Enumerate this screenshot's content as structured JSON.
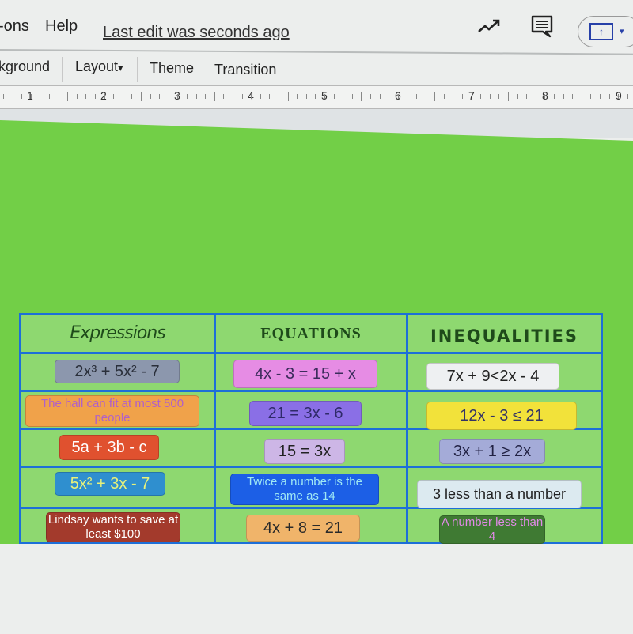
{
  "menubar": {
    "items": [
      "-ons",
      "Help"
    ],
    "last_edit": "Last edit was seconds ago",
    "icons": [
      "activity-trend-icon",
      "comment-icon",
      "present-icon"
    ],
    "present_caret": "▾",
    "present_arrow": "↑"
  },
  "toolbar": {
    "items": [
      "kground",
      "Layout",
      "Theme",
      "Transition"
    ],
    "layout_caret": "▾"
  },
  "ruler": {
    "numbers": [
      "1",
      "2",
      "3",
      "4",
      "5",
      "6",
      "7",
      "8",
      "9"
    ]
  },
  "colors": {
    "slide_background": "#72cf47",
    "table_border": "#1d6fd8",
    "table_cell": "#8ed870"
  },
  "table": {
    "headers": [
      "Expressions",
      "EQUATIONS",
      "INEQUALITIES"
    ],
    "columns": [
      {
        "name": "expressions",
        "cards": [
          {
            "text": "2x³ + 5x² - 7",
            "bg": "#8c97ad",
            "color": "#2a2f3a"
          },
          {
            "text": "The hall can fit at most 500 people",
            "bg": "#f0a24a",
            "color": "#b060c8"
          },
          {
            "text": "5a + 3b - c",
            "bg": "#e0512f",
            "color": "#ffffff"
          },
          {
            "text": "5x² + 3x - 7",
            "bg": "#2f8fcf",
            "color": "#e8f27a"
          },
          {
            "text": "Lindsay wants to save at least $100",
            "bg": "#a33a2c",
            "color": "#ffffff"
          }
        ]
      },
      {
        "name": "equations",
        "cards": [
          {
            "text": "4x - 3 = 15 + x",
            "bg": "#e68ce4",
            "color": "#3c2c5c"
          },
          {
            "text": "21 = 3x - 6",
            "bg": "#8a6fe6",
            "color": "#2f2a6a"
          },
          {
            "text": "15 = 3x",
            "bg": "#cdb6e6",
            "color": "#222222"
          },
          {
            "text": "Twice a number is the same as 14",
            "bg": "#1c5fe6",
            "color": "#9fe8f4"
          },
          {
            "text": "4x + 8 = 21",
            "bg": "#f0b46a",
            "color": "#2a2a2a"
          }
        ]
      },
      {
        "name": "inequalities",
        "cards": [
          {
            "text": "7x + 9<2x - 4",
            "bg": "#eef0f2",
            "color": "#222222"
          },
          {
            "text": "12x - 3 ≤ 21",
            "bg": "#f2e23a",
            "color": "#333366"
          },
          {
            "text": "3x + 1 ≥ 2x",
            "bg": "#a4abd8",
            "color": "#222244"
          },
          {
            "text": "3 less than a number",
            "bg": "#dceaf0",
            "color": "#222222"
          },
          {
            "text": "A number less than 4",
            "bg": "#3f7a33",
            "color": "#e28ae8"
          }
        ]
      }
    ]
  }
}
